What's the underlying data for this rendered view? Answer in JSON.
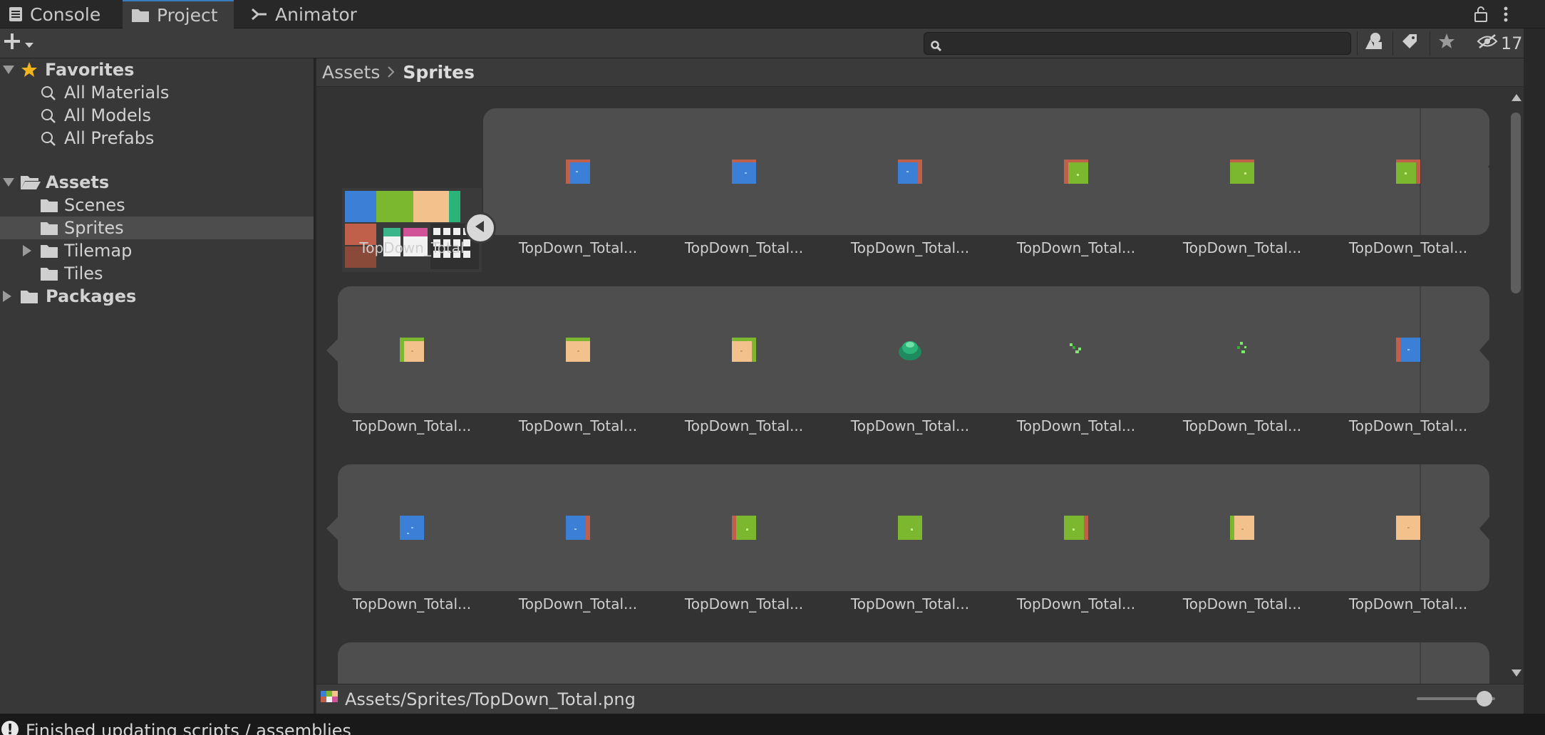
{
  "tabs": [
    {
      "label": "Console",
      "icon": "console-icon"
    },
    {
      "label": "Project",
      "icon": "folder-icon"
    },
    {
      "label": "Animator",
      "icon": "animator-icon"
    }
  ],
  "toolbar": {
    "search_value": "",
    "hidden_count": "17"
  },
  "sidebar": {
    "favorites": {
      "label": "Favorites",
      "items": [
        "All Materials",
        "All Models",
        "All Prefabs"
      ]
    },
    "assets": {
      "label": "Assets",
      "items": [
        "Scenes",
        "Sprites",
        "Tilemap",
        "Tiles"
      ]
    },
    "packages": {
      "label": "Packages"
    }
  },
  "breadcrumb": {
    "root": "Assets",
    "current": "Sprites"
  },
  "grid": {
    "rows": [
      {
        "labels": [
          "TopDown_Total",
          "TopDown_Total...",
          "TopDown_Total...",
          "TopDown_Total...",
          "TopDown_Total...",
          "TopDown_Total...",
          "TopDown_Total..."
        ],
        "tiles": [
          "water-edge-left",
          "water",
          "water-edge-right",
          "grass-edge-left",
          "grass",
          "grass-edge-right"
        ]
      },
      {
        "labels": [
          "TopDown_Total...",
          "TopDown_Total...",
          "TopDown_Total...",
          "TopDown_Total...",
          "TopDown_Total...",
          "TopDown_Total...",
          "TopDown_Total..."
        ],
        "tiles": [
          "sand-grass-left",
          "sand-grass-top",
          "sand-grass-right",
          "bush",
          "sprout",
          "sprout",
          "water-edge-left"
        ]
      },
      {
        "labels": [
          "TopDown_Total...",
          "TopDown_Total...",
          "TopDown_Total...",
          "TopDown_Total...",
          "TopDown_Total...",
          "TopDown_Total...",
          "TopDown_Total..."
        ],
        "tiles": [
          "water",
          "water-edge-right",
          "grass-edge-left",
          "grass",
          "grass-edge-right",
          "sand-edge-left",
          "sand"
        ]
      }
    ]
  },
  "pathbar": {
    "path": "Assets/Sprites/TopDown_Total.png"
  },
  "zoom": {
    "value": 0.95
  },
  "status": {
    "message": "Finished updating scripts / assemblies"
  },
  "colors": {
    "water": "#3b7fd6",
    "grass": "#7cb82f",
    "sand": "#f2c18c",
    "brick": "#c0604a",
    "bush": "#2bb37a",
    "sprout": "#7de86b"
  }
}
